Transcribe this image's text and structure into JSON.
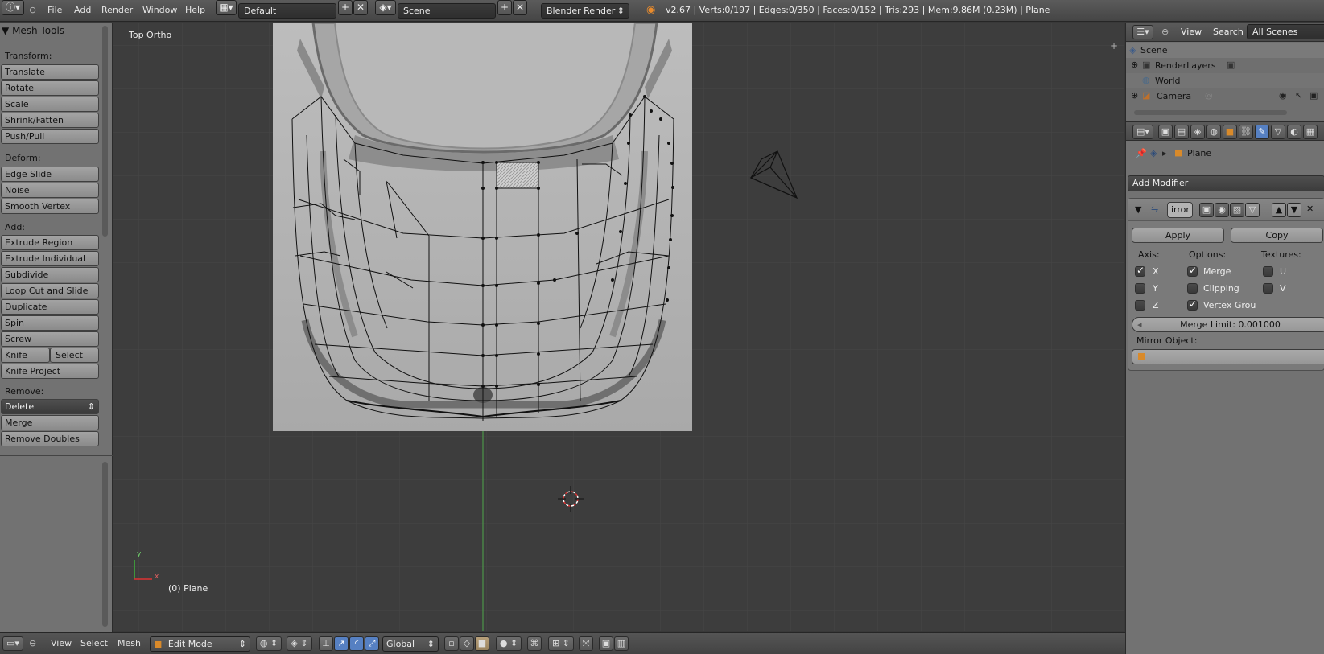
{
  "header": {
    "info_icon": "info-icon",
    "menus": [
      "File",
      "Add",
      "Render",
      "Window",
      "Help"
    ],
    "screen_layout": "Default",
    "scene": "Scene",
    "render_engine": "Blender Render",
    "stats": "v2.67 | Verts:0/197 | Edges:0/350 | Faces:0/152 | Tris:293 | Mem:9.86M (0.23M) | Plane"
  },
  "toolshelf": {
    "title": "Mesh Tools",
    "transform_label": "Transform:",
    "transform": [
      "Translate",
      "Rotate",
      "Scale",
      "Shrink/Fatten",
      "Push/Pull"
    ],
    "deform_label": "Deform:",
    "deform": [
      "Edge Slide",
      "Noise",
      "Smooth Vertex"
    ],
    "add_label": "Add:",
    "add": [
      "Extrude Region",
      "Extrude Individual",
      "Subdivide",
      "Loop Cut and Slide",
      "Duplicate",
      "Spin",
      "Screw"
    ],
    "knife": "Knife",
    "knife_select": "Select",
    "knife_project": "Knife Project",
    "remove_label": "Remove:",
    "delete": "Delete",
    "merge": "Merge",
    "remove_doubles": "Remove Doubles"
  },
  "viewport": {
    "view_label": "Top Ortho",
    "object_label": "(0) Plane",
    "axis_y": "y",
    "axis_x": "x"
  },
  "outliner": {
    "view": "View",
    "search": "Search",
    "filter": "All Scenes",
    "items": [
      "Scene",
      "RenderLayers",
      "World",
      "Camera"
    ]
  },
  "properties": {
    "object_name": "Plane",
    "add_modifier": "Add Modifier",
    "modifier_name": "irror",
    "apply": "Apply",
    "copy": "Copy",
    "axis_label": "Axis:",
    "options_label": "Options:",
    "textures_label": "Textures:",
    "axis": [
      {
        "label": "X",
        "checked": true
      },
      {
        "label": "Y",
        "checked": false
      },
      {
        "label": "Z",
        "checked": false
      }
    ],
    "options": [
      {
        "label": "Merge",
        "checked": true
      },
      {
        "label": "Clipping",
        "checked": false
      },
      {
        "label": "Vertex Grou",
        "checked": true
      }
    ],
    "textures": [
      {
        "label": "U",
        "checked": false
      },
      {
        "label": "V",
        "checked": false
      }
    ],
    "merge_limit": "Merge Limit: 0.001000",
    "mirror_object_label": "Mirror Object:"
  },
  "footer": {
    "menus": [
      "View",
      "Select",
      "Mesh"
    ],
    "mode": "Edit Mode",
    "orientation": "Global"
  },
  "colors": {
    "accent": "#5680c2",
    "header": "#4b4b4b",
    "panel": "#727272",
    "viewport": "#3d3d3d"
  }
}
